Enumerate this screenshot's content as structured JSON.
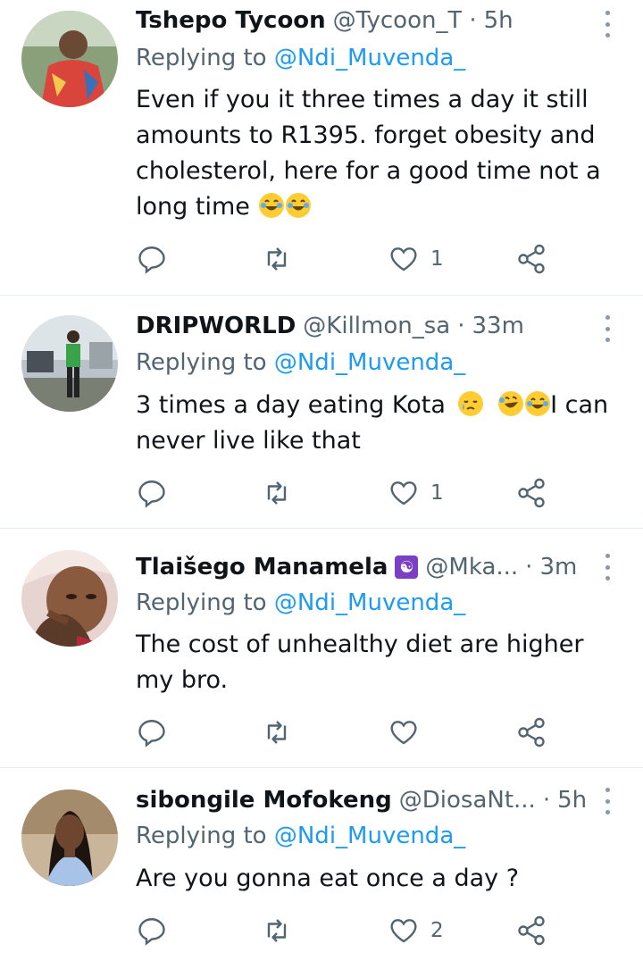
{
  "colors": {
    "link": "#1d9bf0",
    "muted": "#536471",
    "divider": "#e6ecf0"
  },
  "tweets": [
    {
      "name": "Tshepo Tycoon",
      "handle": "@Tycoon_T",
      "time": "5h",
      "reply_prefix": "Replying to",
      "reply_to": "@Ndi_Muvenda_",
      "text": "Even if you it three times a day it still amounts to R1395. forget obesity and cholesterol, here for a good time not a long time",
      "emoji": [
        "tears-of-joy",
        "tears-of-joy"
      ],
      "likes": "1"
    },
    {
      "name": "DRIPWORLD",
      "handle": "@Killmon_sa",
      "time": "33m",
      "reply_prefix": "Replying to",
      "reply_to": "@Ndi_Muvenda_",
      "text_a": "3 times a day eating Kota",
      "text_b": "I can never live like that",
      "emoji": [
        "sleepy-face",
        "rolling-laughing",
        "tears-of-joy"
      ],
      "likes": "1"
    },
    {
      "name": "Tlaišego Manamela",
      "badge": "☯",
      "handle": "@Mka...",
      "time": "3m",
      "reply_prefix": "Replying to",
      "reply_to": "@Ndi_Muvenda_",
      "text": "The cost of unhealthy diet are higher my bro.",
      "likes": ""
    },
    {
      "name": "sibongile Mofokeng",
      "handle": "@DiosaNt...",
      "time": "5h",
      "reply_prefix": "Replying to",
      "reply_to": "@Ndi_Muvenda_",
      "text": "Are you gonna eat once a day ?",
      "likes": "2"
    }
  ],
  "separator": "·"
}
